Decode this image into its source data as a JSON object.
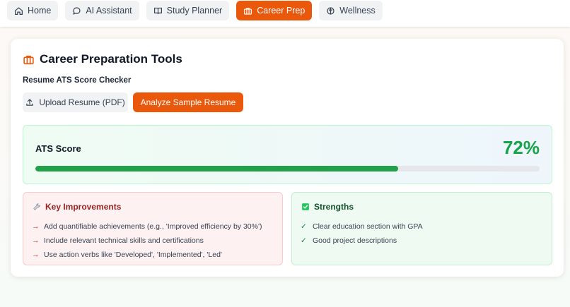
{
  "nav": {
    "tabs": [
      {
        "label": "Home",
        "icon": "home-icon",
        "active": false
      },
      {
        "label": "AI Assistant",
        "icon": "chat-bubble-icon",
        "active": false
      },
      {
        "label": "Study Planner",
        "icon": "book-icon",
        "active": false
      },
      {
        "label": "Career Prep",
        "icon": "briefcase-icon",
        "active": true
      },
      {
        "label": "Wellness",
        "icon": "brain-icon",
        "active": false
      }
    ]
  },
  "card": {
    "title": "Career Preparation Tools",
    "title_icon": "briefcase-icon",
    "section_label": "Resume ATS Score Checker",
    "upload_label": "Upload Resume (PDF)",
    "upload_icon": "upload-icon",
    "analyze_label": "Analyze Sample Resume"
  },
  "score": {
    "label": "ATS Score",
    "value": 72,
    "value_text": "72%"
  },
  "improvements": {
    "title": "Key Improvements",
    "icon": "wrench-icon",
    "marker": "→",
    "items": [
      "Add quantifiable achievements (e.g., 'Improved efficiency by 30%')",
      "Include relevant technical skills and certifications",
      "Use action verbs like 'Developed', 'Implemented', 'Led'"
    ]
  },
  "strengths": {
    "title": "Strengths",
    "icon": "check-square-icon",
    "marker": "✓",
    "items": [
      "Clear education section with GPA",
      "Good project descriptions"
    ]
  },
  "colors": {
    "accent": "#ea580c",
    "score": "#16a34a",
    "danger": "#dc2626",
    "success": "#22c55e"
  }
}
